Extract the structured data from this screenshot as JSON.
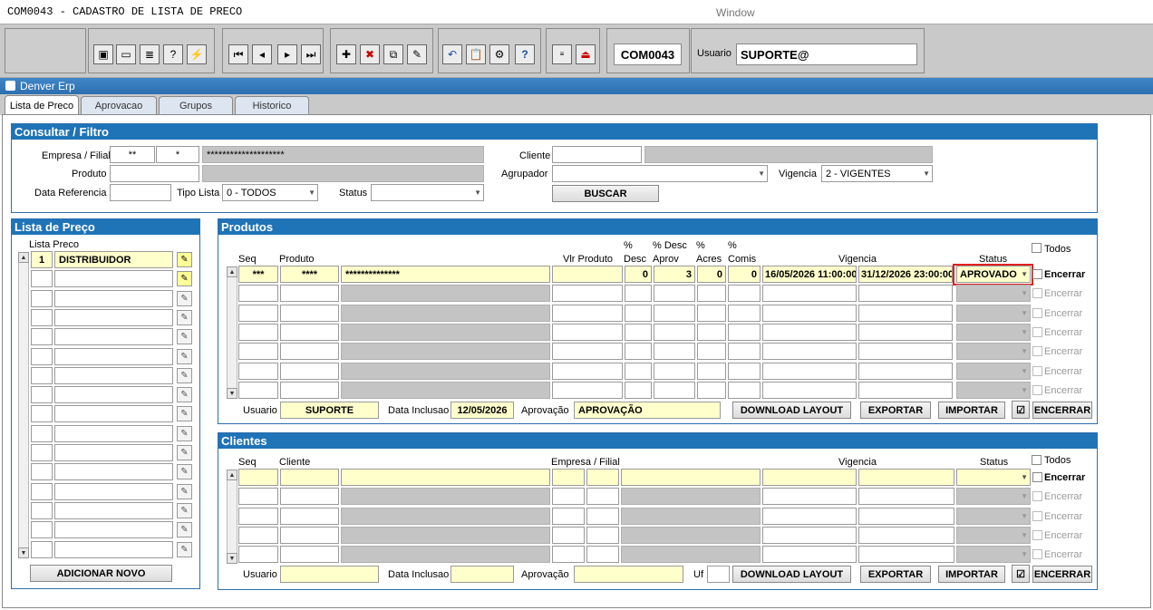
{
  "window": {
    "app_title": "COM0043 - CADASTRO DE LISTA DE PRECO",
    "title": "Window"
  },
  "toolbar": {
    "module_code": "COM0043",
    "usuario_label": "Usuario",
    "usuario_value": "SUPORTE@"
  },
  "erp": {
    "title": "Denver Erp"
  },
  "tabs": [
    {
      "label": "Lista de Preco"
    },
    {
      "label": "Aprovacao"
    },
    {
      "label": "Grupos"
    },
    {
      "label": "Historico"
    }
  ],
  "filtro": {
    "title": "Consultar / Filtro",
    "empresa_filial_label": "Empresa / Filial",
    "empresa_value": "**",
    "filial_value": "*",
    "empresa_name": "********************",
    "produto_label": "Produto",
    "data_referencia_label": "Data Referencia",
    "tipo_lista_label": "Tipo Lista",
    "tipo_lista_value": "0 - TODOS",
    "status_label": "Status",
    "cliente_label": "Cliente",
    "agrupador_label": "Agrupador",
    "vigencia_label": "Vigencia",
    "vigencia_value": "2 - VIGENTES",
    "buscar_label": "BUSCAR"
  },
  "lista_preco": {
    "title": "Lista de Preço",
    "column_label": "Lista Preco",
    "first_code": "1",
    "first_name": "DISTRIBUIDOR",
    "add_label": "ADICIONAR NOVO"
  },
  "produtos": {
    "title": "Produtos",
    "todos_label": "Todos",
    "headers": {
      "seq": "Seq",
      "produto": "Produto",
      "vlr_produto": "Vlr Produto",
      "desc_pct": "%",
      "desc": "Desc",
      "desc_aprov_pct": "% Desc",
      "aprov": "Aprov",
      "acres_pct": "%",
      "acres": "Acres",
      "comis_pct": "%",
      "comis": "Comis",
      "vigencia": "Vigencia",
      "status": "Status"
    },
    "row1": {
      "seq": "***",
      "produto": "****",
      "descricao": "**************",
      "desc": "0",
      "desc_aprov": "3",
      "acres": "0",
      "comis": "0",
      "vig_ini": "16/05/2026 11:00:00",
      "vig_fim": "31/12/2026 23:00:00",
      "status": "APROVADO",
      "encerrar": "Encerrar"
    },
    "encerrar_label": "Encerrar",
    "footer": {
      "usuario_label": "Usuario",
      "usuario_value": "SUPORTE",
      "data_inclusao_label": "Data Inclusao",
      "data_inclusao_value": "12/05/2026",
      "aprovacao_label": "Aprovação",
      "aprovacao_value": "APROVAÇÃO",
      "download_label": "DOWNLOAD LAYOUT",
      "exportar_label": "EXPORTAR",
      "importar_label": "IMPORTAR",
      "encerrar_label": "ENCERRAR"
    }
  },
  "clientes": {
    "title": "Clientes",
    "todos_label": "Todos",
    "headers": {
      "seq": "Seq",
      "cliente": "Cliente",
      "empresa_filial": "Empresa / Filial",
      "vigencia": "Vigencia",
      "status": "Status"
    },
    "encerrar_label": "Encerrar",
    "footer": {
      "usuario_label": "Usuario",
      "data_inclusao_label": "Data Inclusao",
      "aprovacao_label": "Aprovação",
      "uf_label": "Uf",
      "download_label": "DOWNLOAD LAYOUT",
      "exportar_label": "EXPORTAR",
      "importar_label": "IMPORTAR",
      "encerrar_label": "ENCERRAR"
    }
  }
}
